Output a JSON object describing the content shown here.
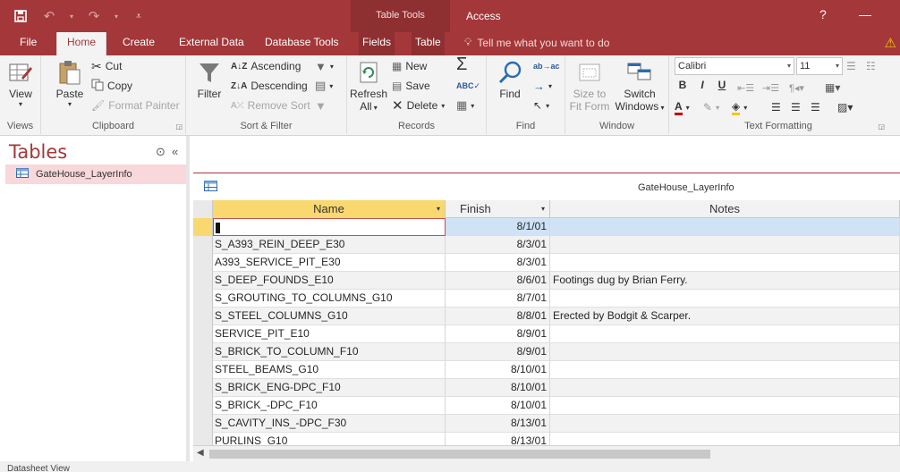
{
  "titlebar": {
    "contextual_label": "Table Tools",
    "app_title": "Access",
    "help_glyph": "?",
    "minimize_glyph": "—"
  },
  "tabs": [
    {
      "label": "File"
    },
    {
      "label": "Home"
    },
    {
      "label": "Create"
    },
    {
      "label": "External Data"
    },
    {
      "label": "Database Tools"
    },
    {
      "label": "Fields"
    },
    {
      "label": "Table"
    }
  ],
  "tell_me": "Tell me what you want to do",
  "ribbon": {
    "views": {
      "label": "Views",
      "view": "View"
    },
    "clipboard": {
      "label": "Clipboard",
      "paste": "Paste",
      "cut": "Cut",
      "copy": "Copy",
      "format_painter": "Format Painter"
    },
    "sort_filter": {
      "label": "Sort & Filter",
      "filter": "Filter",
      "ascending": "Ascending",
      "descending": "Descending",
      "remove_sort": "Remove Sort"
    },
    "records": {
      "label": "Records",
      "refresh": "Refresh",
      "refresh_all": "All",
      "new": "New",
      "save": "Save",
      "delete": "Delete"
    },
    "find": {
      "label": "Find",
      "find": "Find"
    },
    "window": {
      "label": "Window",
      "size_to": "Size to",
      "fit_form": "Fit Form",
      "switch": "Switch",
      "windows": "Windows"
    },
    "text_formatting": {
      "label": "Text Formatting",
      "font": "Calibri",
      "size": "11",
      "bold": "B",
      "italic": "I",
      "underline": "U"
    }
  },
  "nav": {
    "title": "Tables",
    "items": [
      {
        "label": "GateHouse_LayerInfo"
      }
    ]
  },
  "document": {
    "title": "GateHouse_LayerInfo"
  },
  "table": {
    "columns": [
      "Name",
      "Finish",
      "Notes"
    ],
    "rows": [
      {
        "name": "",
        "finish": "8/1/01",
        "notes": ""
      },
      {
        "name": "S_A393_REIN_DEEP_E30",
        "finish": "8/3/01",
        "notes": ""
      },
      {
        "name": "A393_SERVICE_PIT_E30",
        "finish": "8/3/01",
        "notes": ""
      },
      {
        "name": "S_DEEP_FOUNDS_E10",
        "finish": "8/6/01",
        "notes": "Footings dug by Brian Ferry."
      },
      {
        "name": "S_GROUTING_TO_COLUMNS_G10",
        "finish": "8/7/01",
        "notes": ""
      },
      {
        "name": "S_STEEL_COLUMNS_G10",
        "finish": "8/8/01",
        "notes": "Erected by Bodgit & Scarper."
      },
      {
        "name": "SERVICE_PIT_E10",
        "finish": "8/9/01",
        "notes": ""
      },
      {
        "name": "S_BRICK_TO_COLUMN_F10",
        "finish": "8/9/01",
        "notes": ""
      },
      {
        "name": "STEEL_BEAMS_G10",
        "finish": "8/10/01",
        "notes": ""
      },
      {
        "name": "S_BRICK_ENG-DPC_F10",
        "finish": "8/10/01",
        "notes": ""
      },
      {
        "name": "S_BRICK_-DPC_F10",
        "finish": "8/10/01",
        "notes": ""
      },
      {
        "name": "S_CAVITY_INS_-DPC_F30",
        "finish": "8/13/01",
        "notes": ""
      },
      {
        "name": "PURLINS_G10",
        "finish": "8/13/01",
        "notes": ""
      }
    ]
  },
  "status": {
    "text": "Datasheet View"
  },
  "colors": {
    "accent": "#a4373a",
    "selected_header": "#f9d870",
    "current_row": "#cfe2f6"
  }
}
